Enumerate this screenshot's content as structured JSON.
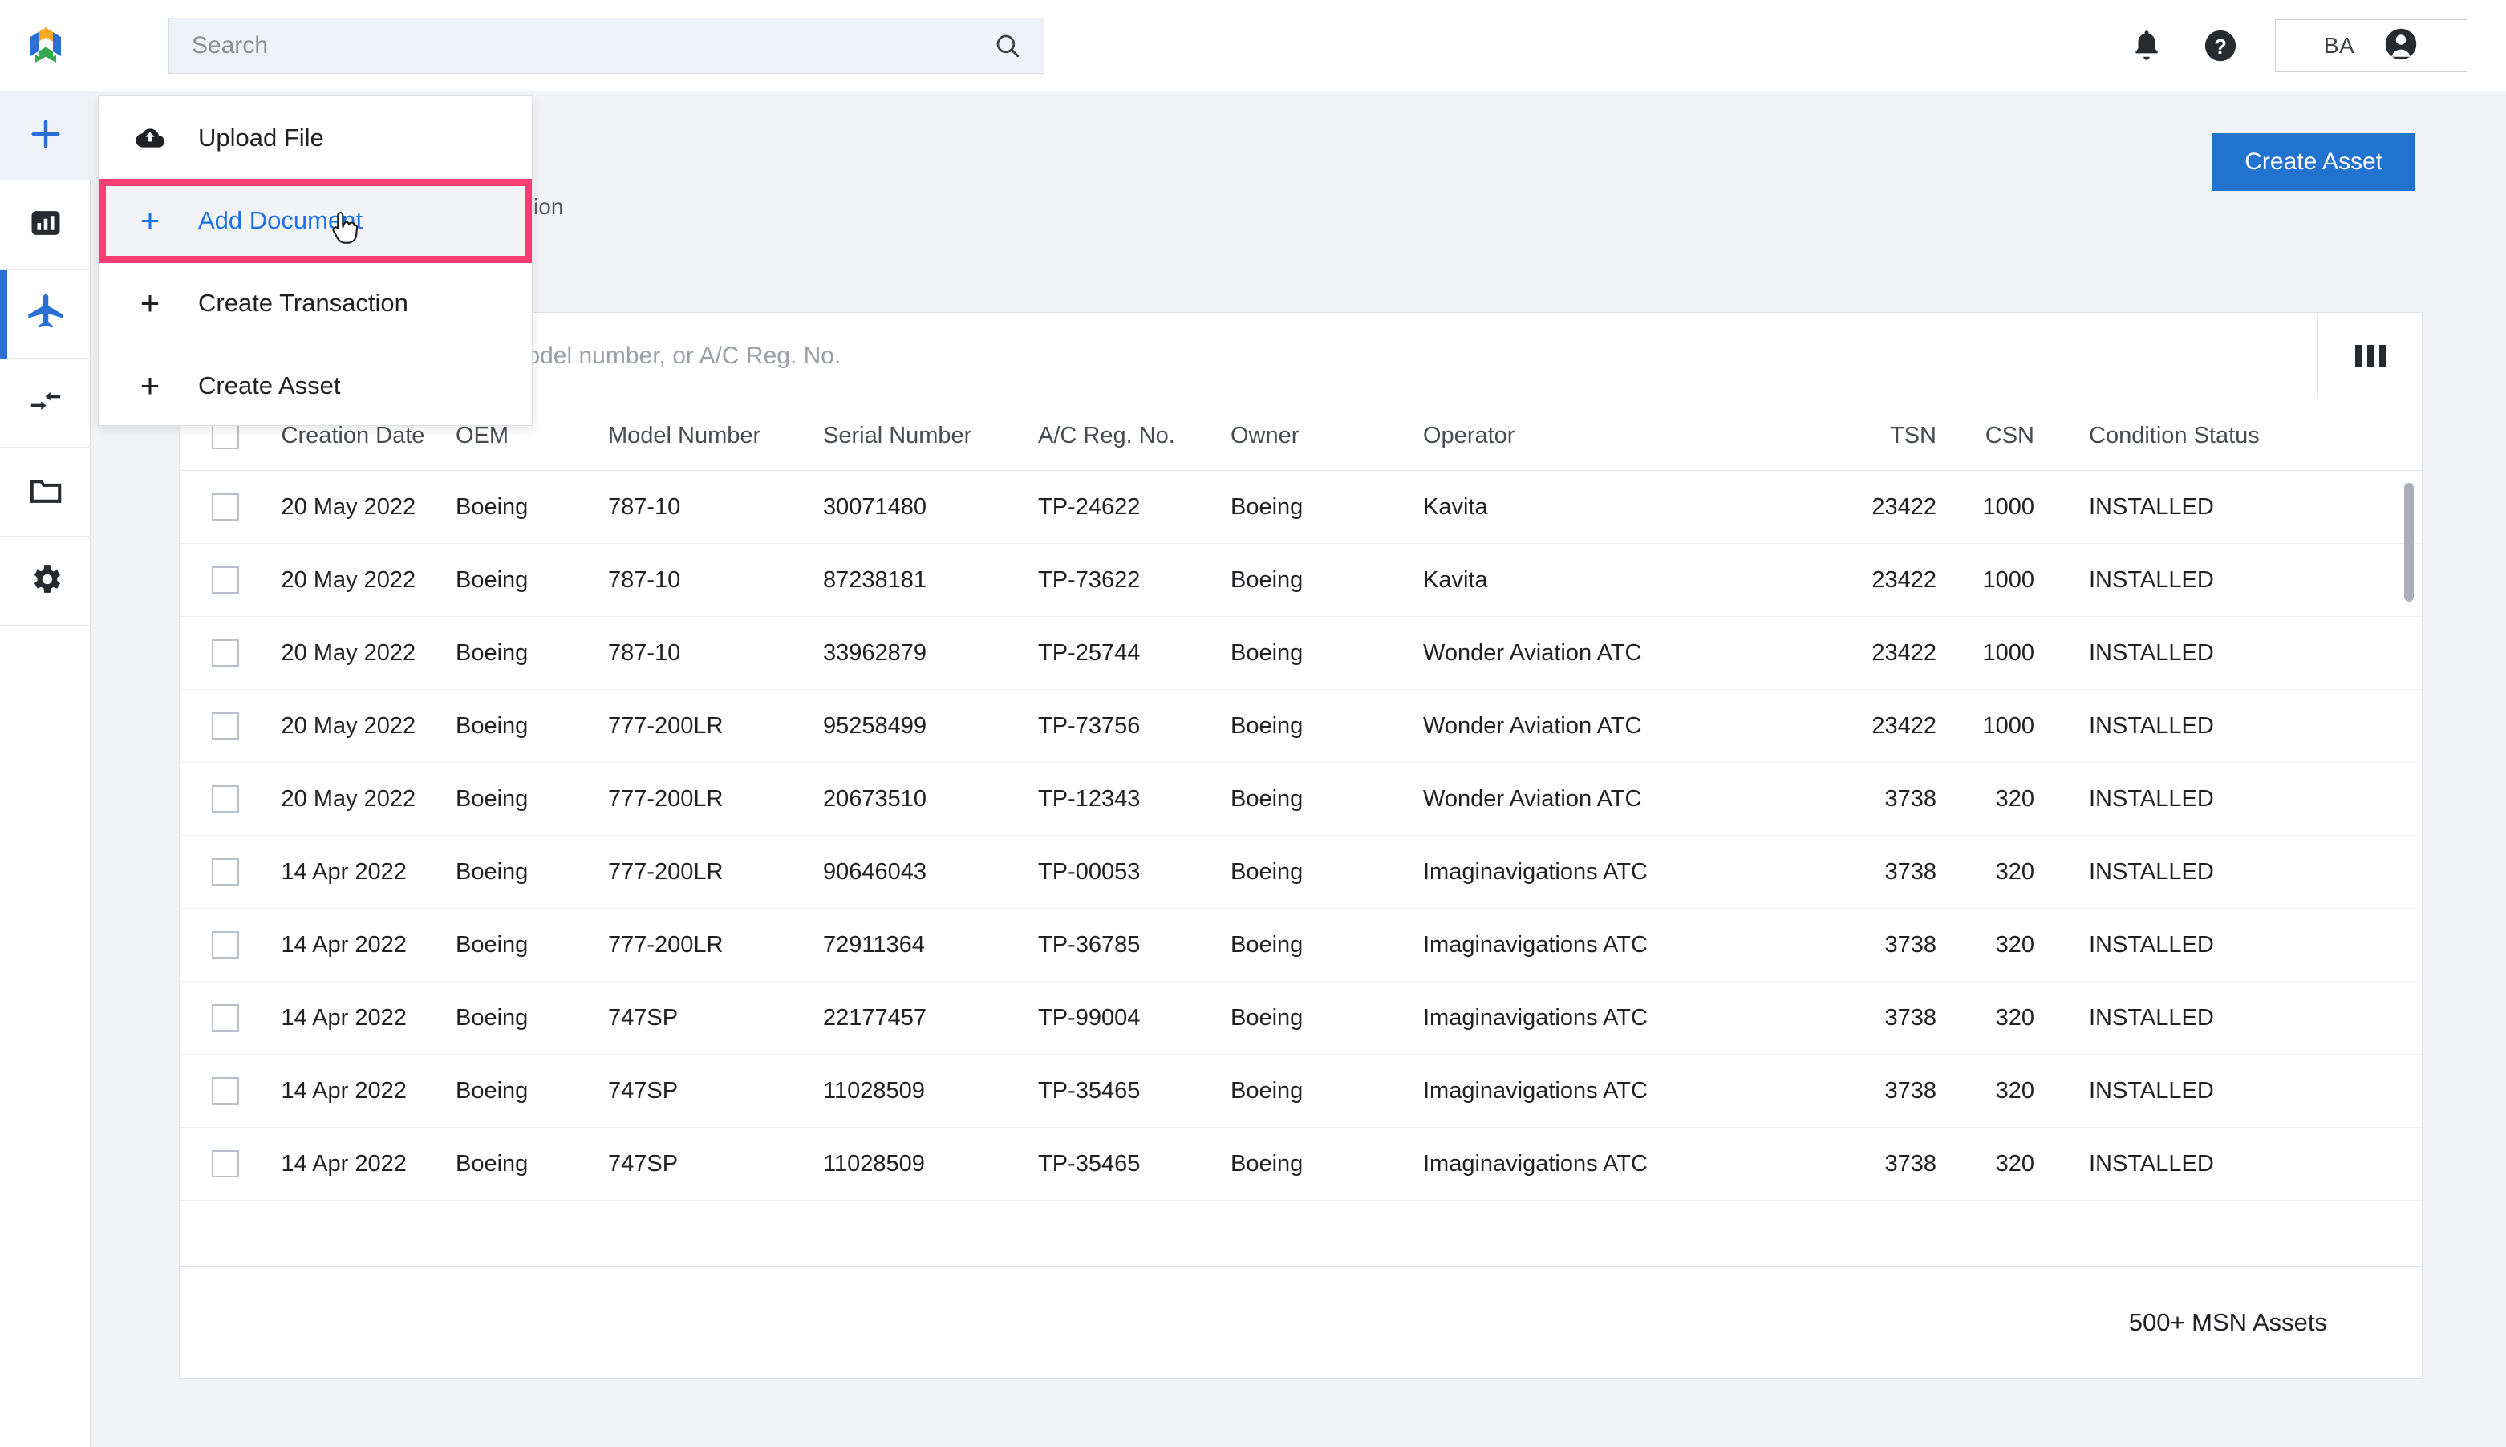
{
  "topbar": {
    "logo_name": "app-logo",
    "search": {
      "value": "",
      "placeholder": "Search"
    },
    "notifications_icon": "bell-icon",
    "help_icon": "help-circle-icon",
    "user_initials": "BA",
    "avatar_icon": "person-icon"
  },
  "sidebar": {
    "items": [
      {
        "name": "add",
        "icon": "plus-icon",
        "state": "hover"
      },
      {
        "name": "dashboard",
        "icon": "bar-chart-icon",
        "state": "default"
      },
      {
        "name": "aircraft",
        "icon": "airplane-icon",
        "state": "selected"
      },
      {
        "name": "transactions",
        "icon": "transfer-arrows-icon",
        "state": "default"
      },
      {
        "name": "documents",
        "icon": "folder-icon",
        "state": "default"
      },
      {
        "name": "settings",
        "icon": "gear-icon",
        "state": "default"
      }
    ]
  },
  "menu": {
    "items": [
      {
        "label": "Upload File",
        "icon": "cloud-upload-icon",
        "highlighted": false
      },
      {
        "label": "Add Document",
        "icon": "plus-icon",
        "highlighted": true
      },
      {
        "label": "Create Transaction",
        "icon": "plus-icon",
        "highlighted": false
      },
      {
        "label": "Create Asset",
        "icon": "plus-icon",
        "highlighted": false
      }
    ],
    "highlight_color": "#fa3d73",
    "highlight_text_color": "#1a73e8"
  },
  "page": {
    "title": "",
    "subtitle": "ated, or managed by your organization",
    "create_asset_label": "Create Asset",
    "create_asset_color": "#2272d0"
  },
  "toolbar": {
    "search_value": "",
    "search_placeholder": "earch your aircraft by MSN, model number, or A/C Reg. No.",
    "columns_icon": "columns-icon"
  },
  "table": {
    "columns": [
      "Creation Date",
      "OEM",
      "Model Number",
      "Serial Number",
      "A/C Reg. No.",
      "Owner",
      "Operator",
      "TSN",
      "CSN",
      "Condition Status"
    ],
    "rows": [
      {
        "creation_date": "20 May 2022",
        "oem": "Boeing",
        "model": "787-10",
        "serial": "30071480",
        "reg": "TP-24622",
        "owner": "Boeing",
        "operator": "Kavita",
        "tsn": "23422",
        "csn": "1000",
        "condition": "INSTALLED"
      },
      {
        "creation_date": "20 May 2022",
        "oem": "Boeing",
        "model": "787-10",
        "serial": "87238181",
        "reg": "TP-73622",
        "owner": "Boeing",
        "operator": "Kavita",
        "tsn": "23422",
        "csn": "1000",
        "condition": "INSTALLED"
      },
      {
        "creation_date": "20 May 2022",
        "oem": "Boeing",
        "model": "787-10",
        "serial": "33962879",
        "reg": "TP-25744",
        "owner": "Boeing",
        "operator": "Wonder Aviation ATC",
        "tsn": "23422",
        "csn": "1000",
        "condition": "INSTALLED"
      },
      {
        "creation_date": "20 May 2022",
        "oem": "Boeing",
        "model": "777-200LR",
        "serial": "95258499",
        "reg": "TP-73756",
        "owner": "Boeing",
        "operator": "Wonder Aviation ATC",
        "tsn": "23422",
        "csn": "1000",
        "condition": "INSTALLED"
      },
      {
        "creation_date": "20 May 2022",
        "oem": "Boeing",
        "model": "777-200LR",
        "serial": "20673510",
        "reg": "TP-12343",
        "owner": "Boeing",
        "operator": "Wonder Aviation ATC",
        "tsn": "3738",
        "csn": "320",
        "condition": "INSTALLED"
      },
      {
        "creation_date": "14 Apr 2022",
        "oem": "Boeing",
        "model": "777-200LR",
        "serial": "90646043",
        "reg": "TP-00053",
        "owner": "Boeing",
        "operator": "Imaginavigations ATC",
        "tsn": "3738",
        "csn": "320",
        "condition": "INSTALLED"
      },
      {
        "creation_date": "14 Apr 2022",
        "oem": "Boeing",
        "model": "777-200LR",
        "serial": "72911364",
        "reg": "TP-36785",
        "owner": "Boeing",
        "operator": "Imaginavigations ATC",
        "tsn": "3738",
        "csn": "320",
        "condition": "INSTALLED"
      },
      {
        "creation_date": "14 Apr 2022",
        "oem": "Boeing",
        "model": "747SP",
        "serial": "22177457",
        "reg": "TP-99004",
        "owner": "Boeing",
        "operator": "Imaginavigations ATC",
        "tsn": "3738",
        "csn": "320",
        "condition": "INSTALLED"
      },
      {
        "creation_date": "14 Apr 2022",
        "oem": "Boeing",
        "model": "747SP",
        "serial": "11028509",
        "reg": "TP-35465",
        "owner": "Boeing",
        "operator": "Imaginavigations ATC",
        "tsn": "3738",
        "csn": "320",
        "condition": "INSTALLED"
      },
      {
        "creation_date": "14 Apr 2022",
        "oem": "Boeing",
        "model": "747SP",
        "serial": "11028509",
        "reg": "TP-35465",
        "owner": "Boeing",
        "operator": "Imaginavigations ATC",
        "tsn": "3738",
        "csn": "320",
        "condition": "INSTALLED"
      }
    ],
    "footer_count": "500+ MSN Assets"
  }
}
